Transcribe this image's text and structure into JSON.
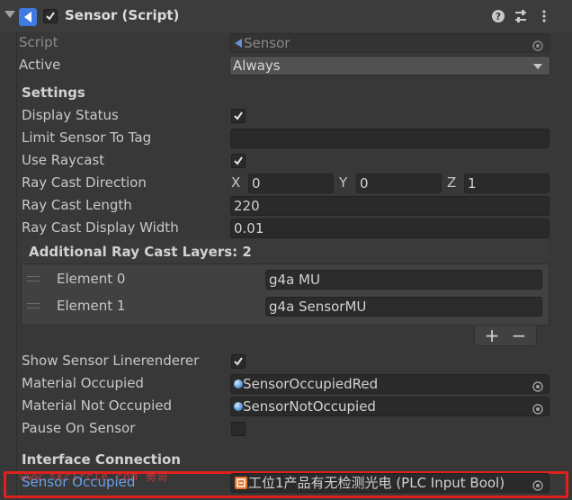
{
  "header": {
    "title": "Sensor (Script)",
    "enabled": true
  },
  "script": {
    "label": "Script",
    "value": "Sensor"
  },
  "active": {
    "label": "Active",
    "value": "Always"
  },
  "settings": {
    "heading": "Settings",
    "display_status": {
      "label": "Display Status",
      "checked": true
    },
    "limit_tag": {
      "label": "Limit Sensor To Tag",
      "value": ""
    },
    "use_raycast": {
      "label": "Use Raycast",
      "checked": true
    },
    "ray_direction": {
      "label": "Ray Cast Direction",
      "x_label": "X",
      "x": "0",
      "y_label": "Y",
      "y": "0",
      "z_label": "Z",
      "z": "1"
    },
    "ray_length": {
      "label": "Ray Cast Length",
      "value": "220"
    },
    "ray_width": {
      "label": "Ray Cast Display Width",
      "value": "0.01"
    }
  },
  "layers": {
    "heading": "Additional Ray Cast Layers: 2",
    "elements": [
      {
        "label": "Element 0",
        "value": "g4a MU"
      },
      {
        "label": "Element 1",
        "value": "g4a SensorMU"
      }
    ],
    "add_label": "+",
    "remove_label": "−"
  },
  "renderer": {
    "show_line": {
      "label": "Show Sensor Linerenderer",
      "checked": true
    },
    "material_occupied": {
      "label": "Material Occupied",
      "value": "SensorOccupiedRed"
    },
    "material_not_occupied": {
      "label": "Material Not Occupied",
      "value": "SensorNotOccupied"
    },
    "pause": {
      "label": "Pause On Sensor",
      "checked": false
    }
  },
  "interface": {
    "heading": "Interface Connection",
    "sensor_occupied": {
      "label": "Sensor Occupied",
      "value": "工位1产品有无检测光电 (PLC Input Bool)"
    }
  },
  "watermark": "www.skcircle.com 勇哥",
  "colors": {
    "highlight": "#e0201c",
    "link": "#6aa1e6",
    "background": "#383838"
  }
}
